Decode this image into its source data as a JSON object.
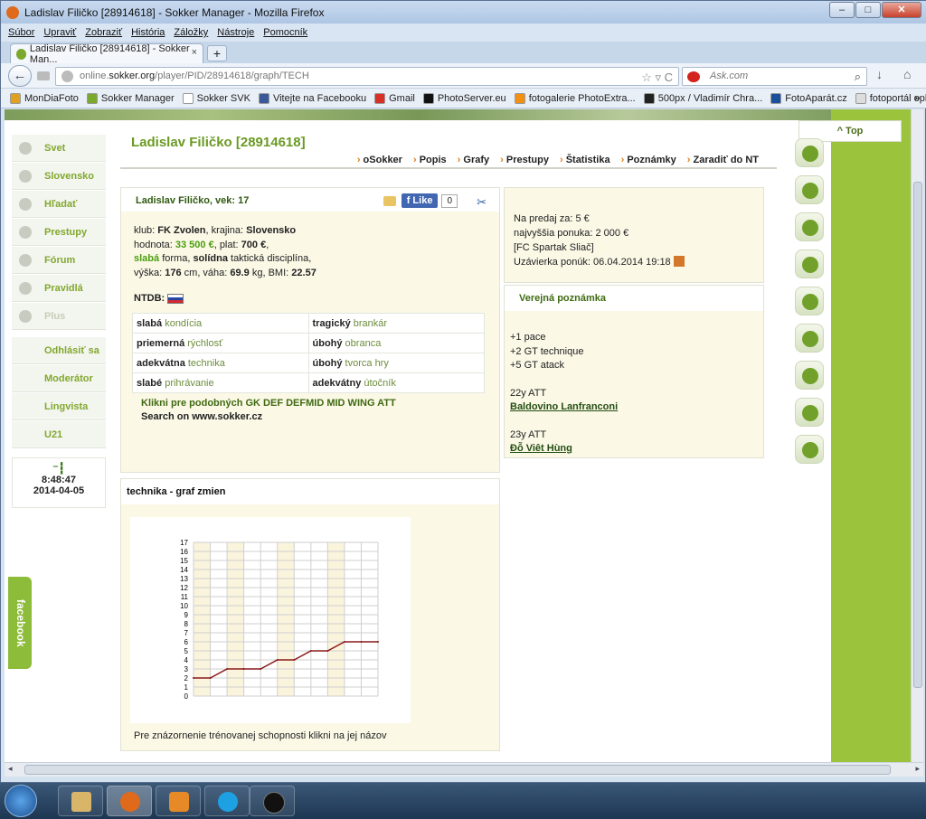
{
  "window": {
    "title": "Ladislav Filičko [28914618] - Sokker Manager - Mozilla Firefox",
    "min": "–",
    "max": "□",
    "close": "✕"
  },
  "menu": [
    "Súbor",
    "Upraviť",
    "Zobraziť",
    "História",
    "Záložky",
    "Nástroje",
    "Pomocník"
  ],
  "tab": {
    "title": "Ladislav Filičko [28914618] - Sokker Man...",
    "close": "×",
    "new": "+"
  },
  "nav": {
    "back": "←",
    "url_prefix": "online.",
    "url_domain": "sokker.org",
    "url_path": "/player/PID/28914618/graph/TECH",
    "url_icons": "☆ ▿ C",
    "search_placeholder": "Ask.com",
    "search_icon": "⌕",
    "download_icon": "↓",
    "home_icon": "⌂"
  },
  "bookmarks": [
    {
      "label": "MonDiaFoto",
      "color": "#e0a020"
    },
    {
      "label": "Sokker Manager",
      "color": "#7aa92e"
    },
    {
      "label": "Sokker SVK",
      "color": "#ffffff"
    },
    {
      "label": "Vitejte na Facebooku",
      "color": "#3b5998"
    },
    {
      "label": "Gmail",
      "color": "#d93025"
    },
    {
      "label": "PhotoServer.eu",
      "color": "#111111"
    },
    {
      "label": "fotogalerie PhotoExtra...",
      "color": "#f29111"
    },
    {
      "label": "500px / Vladimír Chra...",
      "color": "#222222"
    },
    {
      "label": "FotoAparát.cz",
      "color": "#1a4f9c"
    },
    {
      "label": "fotoportál ephoto.sk",
      "color": "#dddddd"
    }
  ],
  "bookmarks_more": "»",
  "top_button": "^ Top",
  "leftnav": {
    "items": [
      {
        "label": "Svet",
        "disabled": false
      },
      {
        "label": "Slovensko",
        "disabled": false
      },
      {
        "label": "Hľadať",
        "disabled": false
      },
      {
        "label": "Prestupy",
        "disabled": false
      },
      {
        "label": "Fórum",
        "disabled": false
      },
      {
        "label": "Pravidlá",
        "disabled": false
      },
      {
        "label": "Plus",
        "disabled": true
      }
    ],
    "items2": [
      "Odhlásiť sa",
      "Moderátor",
      "Lingvista",
      "U21"
    ],
    "clock_icon": "⁻┇",
    "time": "8:48:47",
    "date": "2014-04-05"
  },
  "facebook_tab": "facebook",
  "header": {
    "name": "Ladislav Filičko [28914618]",
    "tabs": [
      "oSokker",
      "Popis",
      "Grafy",
      "Prestupy",
      "Štatistika",
      "Poznámky",
      "Zaradiť do NT"
    ]
  },
  "player": {
    "title": "Ladislav Filičko, vek: 17",
    "like": "f Like",
    "like_count": "0",
    "scissors_icon": "✂",
    "club_label": "klub: ",
    "club": "FK Zvolen",
    "country_label": ", krajina: ",
    "country": "Slovensko",
    "value_label": "hodnota: ",
    "value": "33 500 €",
    "salary_label": ", plat: ",
    "salary": "700 €",
    "form_word": "slabá",
    "form_rest": " forma, ",
    "tactic_word": "solídna",
    "tactic_rest": " taktická disciplína,",
    "height_label": "výška: ",
    "height": "176",
    "weight_label": " cm, váha: ",
    "weight": "69.9",
    "bmi_label": " kg, BMI: ",
    "bmi": "22.57",
    "ntdb": "NTDB:",
    "skills": [
      [
        {
          "level": "slabá",
          "name": " kondícia"
        },
        {
          "level": "tragický",
          "name": " brankár"
        }
      ],
      [
        {
          "level": "priemerná",
          "name": " rýchlosť"
        },
        {
          "level": "úbohý",
          "name": " obranca"
        }
      ],
      [
        {
          "level": "adekvátna",
          "name": " technika"
        },
        {
          "level": "úbohý",
          "name": " tvorca hry"
        }
      ],
      [
        {
          "level": "slabé",
          "name": " prihrávanie"
        },
        {
          "level": "adekvátny",
          "name": " útočník"
        }
      ]
    ],
    "similar": "Klikni pre podobných GK DEF DEFMID MID WING ATT",
    "search": "Search on www.sokker.cz"
  },
  "sale": {
    "line1": "Na predaj za: 5 €",
    "line2": "najvyššia ponuka: 2 000 €",
    "line3": "[FC Spartak Sliač]",
    "line4": "Uzávierka ponúk: 06.04.2014 19:18"
  },
  "note": {
    "title": "Verejná poznámka",
    "lines": [
      "+1 pace",
      "+2 GT technique",
      "+5 GT atack"
    ],
    "l1": "22y ATT",
    "link1": "Baldovino Lanfranconi",
    "l2": "23y ATT",
    "link2": "Đỗ Viêt Hùng"
  },
  "graph": {
    "title": "technika - graf zmien",
    "caption": "Pre znázornenie trénovanej schopnosti klikni na jej názov"
  },
  "chart_data": {
    "type": "line",
    "x": [
      1,
      2,
      3,
      4,
      5,
      6,
      7,
      8,
      9,
      10,
      11,
      12
    ],
    "values": [
      2,
      2,
      3,
      3,
      3,
      4,
      4,
      5,
      5,
      6,
      6,
      6
    ],
    "ylim": [
      0,
      17
    ],
    "yticks": [
      "0",
      "1",
      "2",
      "3",
      "4",
      "5",
      "6",
      "7",
      "8",
      "9",
      "10",
      "11",
      "12",
      "13",
      "14",
      "15",
      "16",
      "17"
    ],
    "grid": true,
    "line_color": "#8a1a1a"
  },
  "hscroll": {
    "left": "◂",
    "right": "▸"
  }
}
